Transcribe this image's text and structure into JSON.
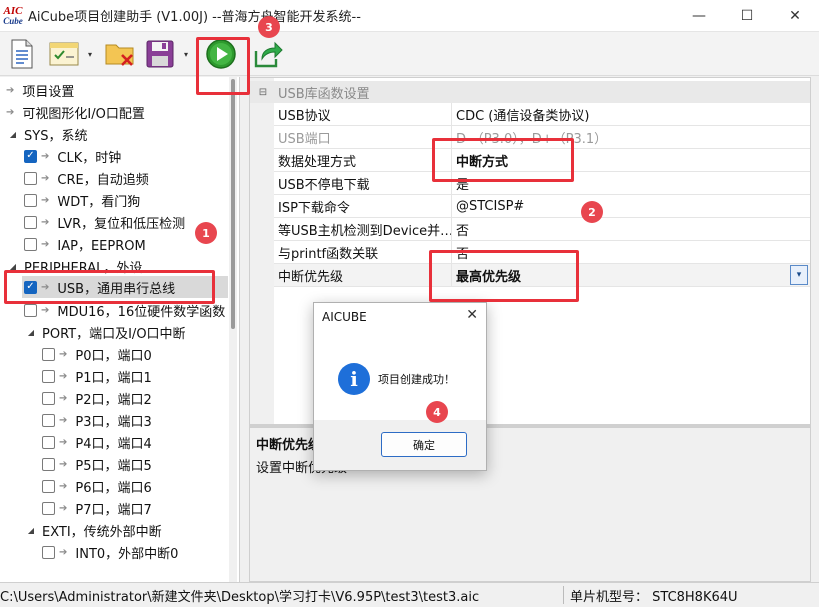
{
  "window": {
    "logo_line1": "AIC",
    "logo_line2": "Cube",
    "title": "AiCube项目创建助手 (V1.00J) --普海方舟智能开发系统--",
    "minimize_glyph": "—",
    "maximize_glyph": "☐",
    "close_glyph": "✕"
  },
  "toolbar": {
    "icons": [
      "new-document-icon",
      "settings-list-icon",
      "delete-folder-icon",
      "save-icon",
      "run-play-icon",
      "export-share-icon"
    ],
    "dropdown_glyph": "▾"
  },
  "tree": {
    "rows": [
      {
        "label": "项目设置",
        "kind": "arrow"
      },
      {
        "label": "可视图形化I/O口配置",
        "kind": "arrow"
      },
      {
        "label": "SYS，系统",
        "kind": "group"
      },
      {
        "label": "CLK，时钟",
        "kind": "check",
        "checked": true
      },
      {
        "label": "CRE，自动追频",
        "kind": "check",
        "checked": false
      },
      {
        "label": "WDT，看门狗",
        "kind": "check",
        "checked": false
      },
      {
        "label": "LVR，复位和低压检测",
        "kind": "check",
        "checked": false
      },
      {
        "label": "IAP，EEPROM",
        "kind": "check",
        "checked": false
      },
      {
        "label": "PERIPHERAL，外设",
        "kind": "group"
      },
      {
        "label": "USB，通用串行总线",
        "kind": "check",
        "checked": true,
        "selected": true
      },
      {
        "label": "MDU16，16位硬件数学函数",
        "kind": "check",
        "checked": false
      },
      {
        "label": "PORT，端口及I/O口中断",
        "kind": "group"
      },
      {
        "label": "P0口，端口0",
        "kind": "check",
        "checked": false
      },
      {
        "label": "P1口，端口1",
        "kind": "check",
        "checked": false
      },
      {
        "label": "P2口，端口2",
        "kind": "check",
        "checked": false
      },
      {
        "label": "P3口，端口3",
        "kind": "check",
        "checked": false
      },
      {
        "label": "P4口，端口4",
        "kind": "check",
        "checked": false
      },
      {
        "label": "P5口，端口5",
        "kind": "check",
        "checked": false
      },
      {
        "label": "P6口，端口6",
        "kind": "check",
        "checked": false
      },
      {
        "label": "P7口，端口7",
        "kind": "check",
        "checked": false
      },
      {
        "label": "EXTI，传统外部中断",
        "kind": "group"
      },
      {
        "label": "INT0，外部中断0",
        "kind": "check",
        "checked": false
      }
    ]
  },
  "grid": {
    "category": "USB库函数设置",
    "rows": [
      {
        "name": "USB协议",
        "value": "CDC (通信设备类协议)"
      },
      {
        "name": "USB端口",
        "value": "D-（P3.0），D+（P3.1）",
        "disabled": true
      },
      {
        "name": "数据处理方式",
        "value": "中断方式",
        "bold": true
      },
      {
        "name": "USB不停电下载",
        "value": "是"
      },
      {
        "name": "ISP下载命令",
        "value": "@STCISP#"
      },
      {
        "name": "等USB主机检测到Device并…",
        "value": "否"
      },
      {
        "name": "与printf函数关联",
        "value": "否"
      },
      {
        "name": "中断优先级",
        "value": "最高优先级",
        "bold": true,
        "current": true
      }
    ],
    "dropdown_glyph": "▾"
  },
  "description": {
    "title": "中断优先级",
    "text": "设置中断优先级"
  },
  "status": {
    "path": "C:\\Users\\Administrator\\新建文件夹\\Desktop\\学习打卡\\V6.95P\\test3\\test3.aic",
    "model": "单片机型号：  STC8H8K64U"
  },
  "dialog": {
    "title": "AICUBE",
    "close_glyph": "✕",
    "info_glyph": "i",
    "message": "项目创建成功！",
    "ok_label": "确定"
  },
  "annotations": {
    "badges": [
      "1",
      "2",
      "3",
      "4"
    ],
    "accent": "#e8303a"
  }
}
